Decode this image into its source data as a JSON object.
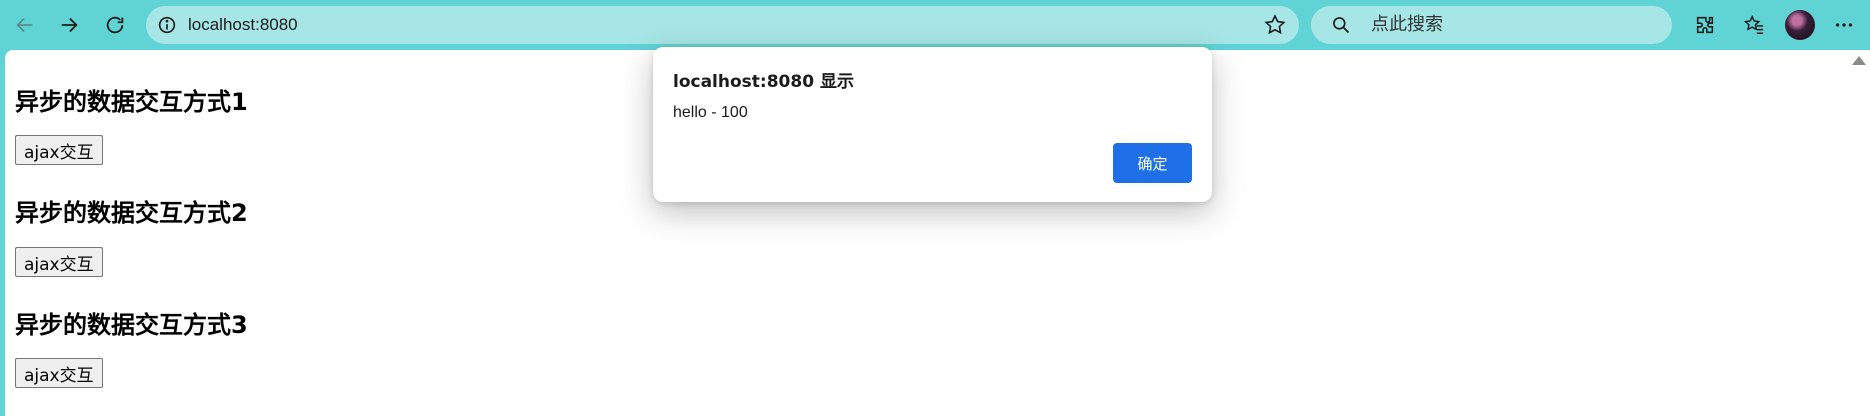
{
  "browser": {
    "address_bar": {
      "url": "localhost:8080"
    },
    "search_box": {
      "placeholder": "点此搜索"
    },
    "icons": [
      "back-icon",
      "forward-icon",
      "refresh-icon",
      "site-info-icon",
      "favorite-star-icon",
      "search-icon",
      "extensions-icon",
      "favorites-icon",
      "profile-avatar",
      "more-icon"
    ]
  },
  "page": {
    "sections": [
      {
        "heading": "异步的数据交互方式1",
        "button_label": "ajax交互"
      },
      {
        "heading": "异步的数据交互方式2",
        "button_label": "ajax交互"
      },
      {
        "heading": "异步的数据交互方式3",
        "button_label": "ajax交互"
      }
    ]
  },
  "dialog": {
    "title": "localhost:8080 显示",
    "message": "hello - 100",
    "ok_label": "确定"
  },
  "colors": {
    "toolbar_bg": "#60d3d5",
    "field_bg": "#a7e6e6",
    "dialog_ok_bg": "#1f6fe8"
  }
}
